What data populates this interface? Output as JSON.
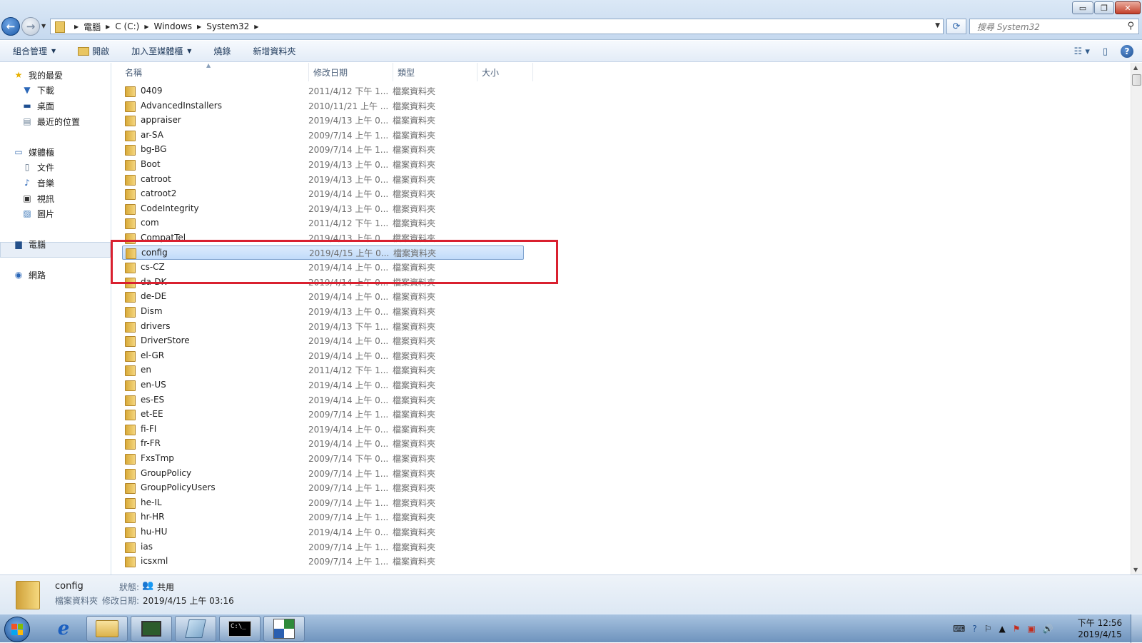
{
  "window": {
    "minimize_glyph": "▭",
    "maximize_glyph": "❐",
    "close_glyph": "✕"
  },
  "address": {
    "breadcrumbs": [
      "電腦",
      "C (C:)",
      "Windows",
      "System32"
    ],
    "search_placeholder": "搜尋 System32"
  },
  "toolbar": {
    "organize": "組合管理",
    "open": "開啟",
    "add_to_library": "加入至媒體櫃",
    "burn": "燒錄",
    "new_folder": "新增資料夾"
  },
  "nav": {
    "favorites": "我的最愛",
    "downloads": "下載",
    "desktop": "桌面",
    "recent": "最近的位置",
    "libraries": "媒體櫃",
    "documents": "文件",
    "music": "音樂",
    "videos": "視訊",
    "pictures": "圖片",
    "computer": "電腦",
    "network": "網路"
  },
  "columns": {
    "name": "名稱",
    "modified": "修改日期",
    "type": "類型",
    "size": "大小"
  },
  "files": [
    {
      "name": "0409",
      "date": "2011/4/12 下午 1...",
      "type": "檔案資料夾"
    },
    {
      "name": "AdvancedInstallers",
      "date": "2010/11/21 上午 ...",
      "type": "檔案資料夾"
    },
    {
      "name": "appraiser",
      "date": "2019/4/13 上午 0...",
      "type": "檔案資料夾"
    },
    {
      "name": "ar-SA",
      "date": "2009/7/14 上午 1...",
      "type": "檔案資料夾"
    },
    {
      "name": "bg-BG",
      "date": "2009/7/14 上午 1...",
      "type": "檔案資料夾"
    },
    {
      "name": "Boot",
      "date": "2019/4/13 上午 0...",
      "type": "檔案資料夾"
    },
    {
      "name": "catroot",
      "date": "2019/4/13 上午 0...",
      "type": "檔案資料夾"
    },
    {
      "name": "catroot2",
      "date": "2019/4/14 上午 0...",
      "type": "檔案資料夾"
    },
    {
      "name": "CodeIntegrity",
      "date": "2019/4/13 上午 0...",
      "type": "檔案資料夾"
    },
    {
      "name": "com",
      "date": "2011/4/12 下午 1...",
      "type": "檔案資料夾"
    },
    {
      "name": "CompatTel",
      "date": "2019/4/13 上午 0...",
      "type": "檔案資料夾"
    },
    {
      "name": "config",
      "date": "2019/4/15 上午 0...",
      "type": "檔案資料夾",
      "selected": true
    },
    {
      "name": "cs-CZ",
      "date": "2019/4/14 上午 0...",
      "type": "檔案資料夾"
    },
    {
      "name": "da-DK",
      "date": "2019/4/14 上午 0...",
      "type": "檔案資料夾"
    },
    {
      "name": "de-DE",
      "date": "2019/4/14 上午 0...",
      "type": "檔案資料夾"
    },
    {
      "name": "Dism",
      "date": "2019/4/13 上午 0...",
      "type": "檔案資料夾"
    },
    {
      "name": "drivers",
      "date": "2019/4/13 下午 1...",
      "type": "檔案資料夾"
    },
    {
      "name": "DriverStore",
      "date": "2019/4/14 上午 0...",
      "type": "檔案資料夾"
    },
    {
      "name": "el-GR",
      "date": "2019/4/14 上午 0...",
      "type": "檔案資料夾"
    },
    {
      "name": "en",
      "date": "2011/4/12 下午 1...",
      "type": "檔案資料夾"
    },
    {
      "name": "en-US",
      "date": "2019/4/14 上午 0...",
      "type": "檔案資料夾"
    },
    {
      "name": "es-ES",
      "date": "2019/4/14 上午 0...",
      "type": "檔案資料夾"
    },
    {
      "name": "et-EE",
      "date": "2009/7/14 上午 1...",
      "type": "檔案資料夾"
    },
    {
      "name": "fi-FI",
      "date": "2019/4/14 上午 0...",
      "type": "檔案資料夾"
    },
    {
      "name": "fr-FR",
      "date": "2019/4/14 上午 0...",
      "type": "檔案資料夾"
    },
    {
      "name": "FxsTmp",
      "date": "2009/7/14 下午 0...",
      "type": "檔案資料夾"
    },
    {
      "name": "GroupPolicy",
      "date": "2009/7/14 上午 1...",
      "type": "檔案資料夾"
    },
    {
      "name": "GroupPolicyUsers",
      "date": "2009/7/14 上午 1...",
      "type": "檔案資料夾"
    },
    {
      "name": "he-IL",
      "date": "2009/7/14 上午 1...",
      "type": "檔案資料夾"
    },
    {
      "name": "hr-HR",
      "date": "2009/7/14 上午 1...",
      "type": "檔案資料夾"
    },
    {
      "name": "hu-HU",
      "date": "2019/4/14 上午 0...",
      "type": "檔案資料夾"
    },
    {
      "name": "ias",
      "date": "2009/7/14 上午 1...",
      "type": "檔案資料夾"
    },
    {
      "name": "icsxml",
      "date": "2009/7/14 上午 1...",
      "type": "檔案資料夾"
    }
  ],
  "details": {
    "name": "config",
    "type": "檔案資料夾",
    "state_label": "狀態:",
    "state_value": "共用",
    "modified_label": "修改日期:",
    "modified_value": "2019/4/15 上午 03:16"
  },
  "taskbar": {
    "time": "下午 12:56",
    "date": "2019/4/15",
    "cmd_text": "C:\\_"
  },
  "colors": {
    "highlight_box": "#d9202f",
    "selection": "#c1dbfa",
    "folder": "#e9c662"
  }
}
